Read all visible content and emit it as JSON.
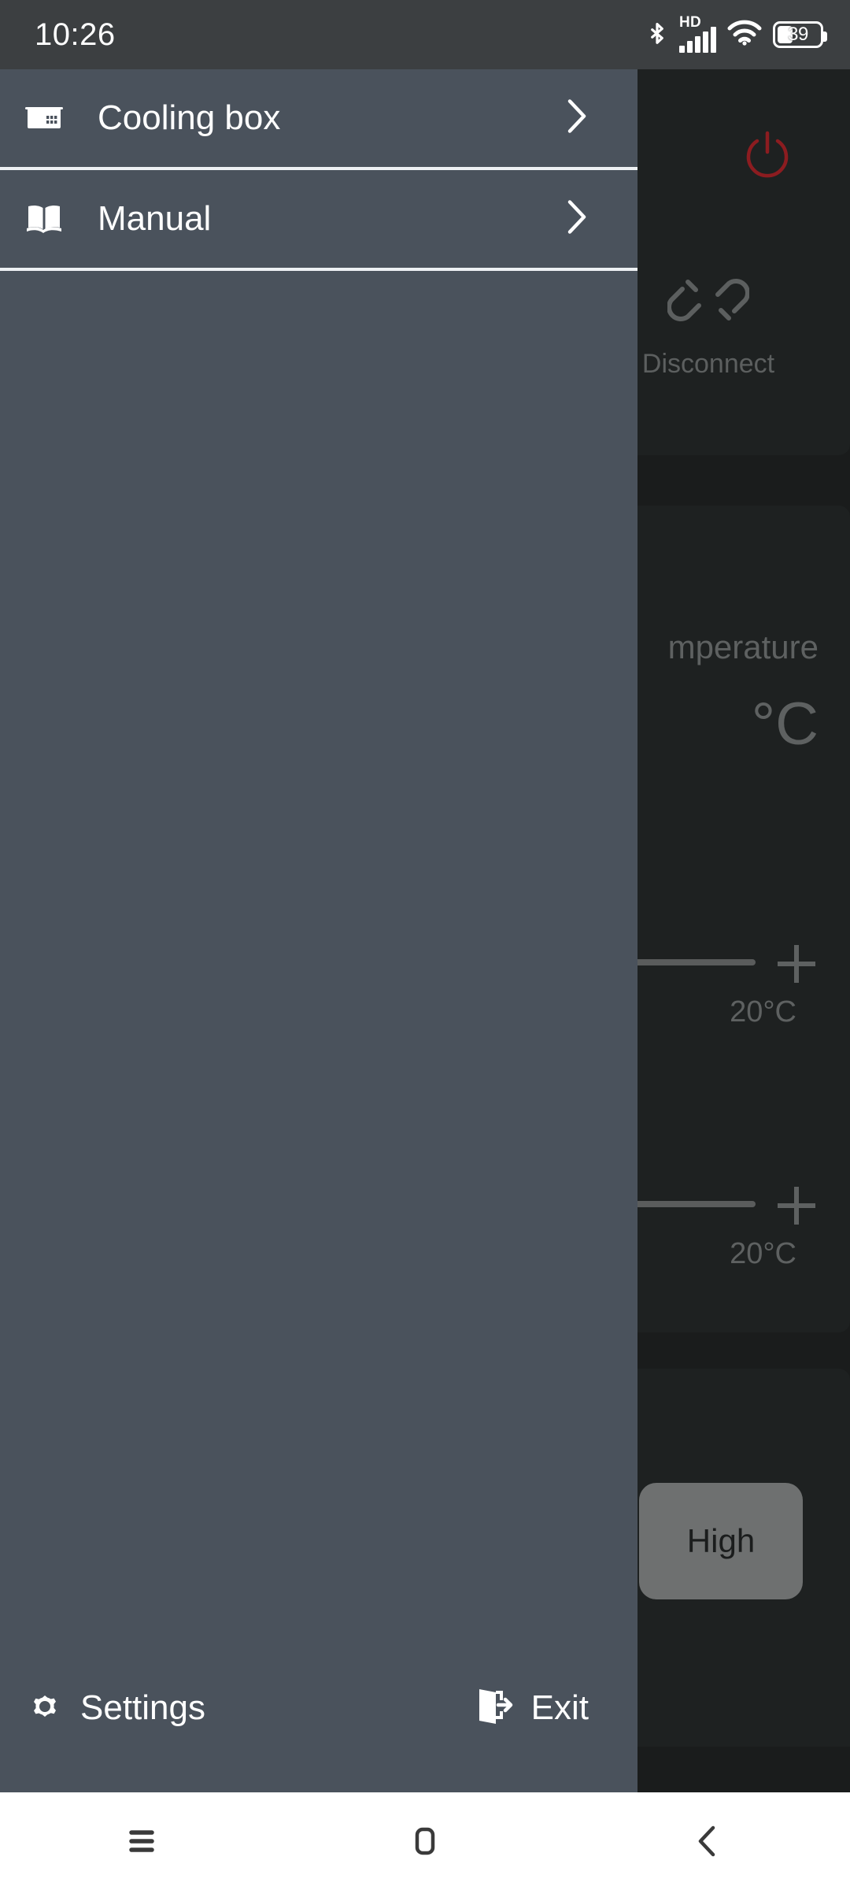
{
  "status_bar": {
    "time": "10:26",
    "bluetooth_icon": "bluetooth-icon",
    "network_type": "HD",
    "signal_icon": "cellular-signal-icon",
    "wifi_icon": "wifi-icon",
    "battery_percent": "39",
    "battery_icon": "battery-icon"
  },
  "drawer": {
    "items": [
      {
        "label": "Cooling box",
        "icon": "cooling-box-icon",
        "chevron": "chevron-right-icon"
      },
      {
        "label": "Manual",
        "icon": "book-icon",
        "chevron": "chevron-right-icon"
      }
    ],
    "footer": {
      "settings_label": "Settings",
      "settings_icon": "gear-icon",
      "exit_label": "Exit",
      "exit_icon": "exit-door-icon"
    }
  },
  "main": {
    "power_icon": "power-icon",
    "power_color": "#8c1c20",
    "disconnect_label": "Disconnect",
    "disconnect_icon": "broken-link-icon",
    "temperature_title": "mperature",
    "temperature_value": "°C",
    "sliders": [
      {
        "value_label": "20°C",
        "plus_icon": "plus-icon",
        "fill_percent": 100
      },
      {
        "value_label": "20°C",
        "plus_icon": "plus-icon",
        "fill_percent": 100
      }
    ],
    "mode_button_label": "High"
  },
  "nav_bar": {
    "recents_icon": "recents-menu-icon",
    "home_icon": "home-square-icon",
    "back_icon": "back-chevron-icon"
  },
  "colors": {
    "drawer_bg": "#4a525c",
    "content_bg": "#1a1c1c",
    "card_bg": "#1e2121",
    "status_bar_bg": "#3c3f41",
    "nav_bar_bg": "#ffffff",
    "accent_power": "#8c1c20",
    "mode_button_bg": "#6e7070"
  }
}
